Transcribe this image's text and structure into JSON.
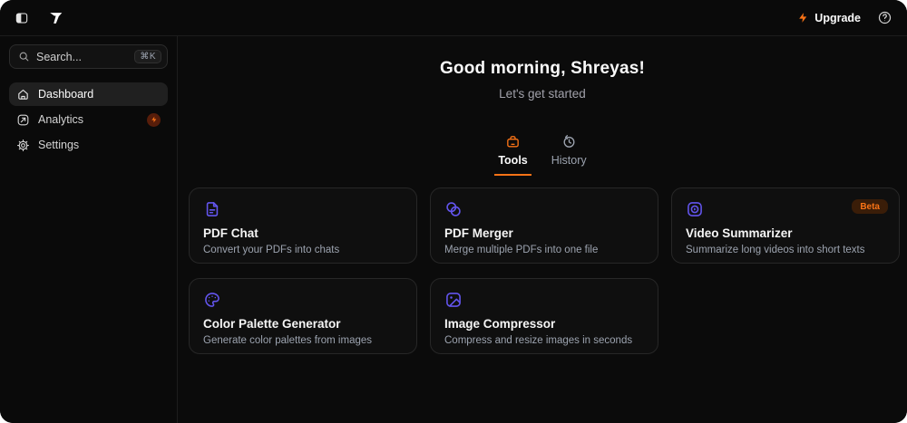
{
  "topbar": {
    "upgrade_label": "Upgrade"
  },
  "sidebar": {
    "search": {
      "placeholder": "Search...",
      "shortcut": "⌘K"
    },
    "items": [
      {
        "label": "Dashboard",
        "icon": "home",
        "active": true
      },
      {
        "label": "Analytics",
        "icon": "trending-square",
        "badge": "bolt"
      },
      {
        "label": "Settings",
        "icon": "gear"
      }
    ]
  },
  "main": {
    "greeting": "Good morning, Shreyas!",
    "subtitle": "Let's get started",
    "tabs": [
      {
        "label": "Tools",
        "icon": "toolbox",
        "active": true
      },
      {
        "label": "History",
        "icon": "history-clock",
        "active": false
      }
    ],
    "cards": [
      {
        "title": "PDF Chat",
        "description": "Convert your PDFs into chats",
        "icon": "file-text"
      },
      {
        "title": "PDF Merger",
        "description": "Merge multiple PDFs into one file",
        "icon": "merge-circles"
      },
      {
        "title": "Video Summarizer",
        "description": "Summarize long videos into short texts",
        "icon": "video-play",
        "badge": "Beta"
      },
      {
        "title": "Color Palette Generator",
        "description": "Generate color palettes from images",
        "icon": "palette"
      },
      {
        "title": "Image Compressor",
        "description": "Compress and resize images in seconds",
        "icon": "image"
      }
    ]
  },
  "colors": {
    "accent_orange": "#f97316",
    "accent_indigo": "#6355ee",
    "background": "#0a0a0a",
    "card_background": "#0f0f0f",
    "border": "#272727",
    "text_primary": "#fafafa",
    "text_secondary": "#9ca3af",
    "beta_badge_bg": "#3a1d08"
  }
}
